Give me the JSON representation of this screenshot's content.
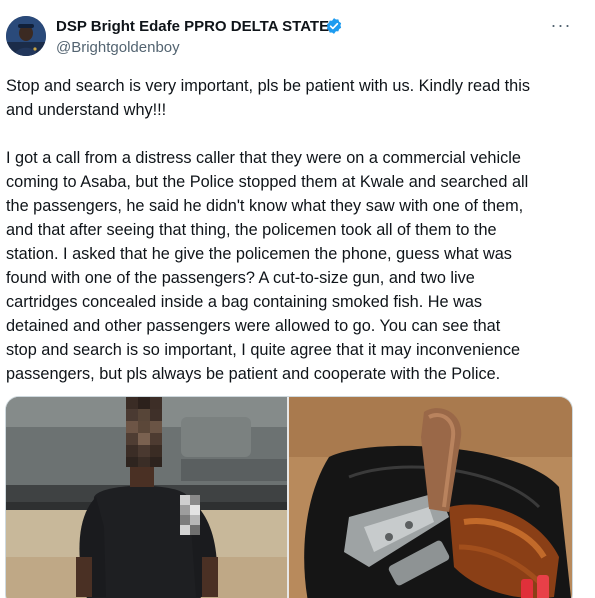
{
  "author": {
    "name": "DSP Bright Edafe PPRO DELTA STATE",
    "handle": "@Brightgoldenboy",
    "verified": true
  },
  "more_label": "···",
  "tweet": {
    "paragraph_1": "Stop and search is very important, pls be patient with us. Kindly read this\nand understand why!!!",
    "paragraph_2": "I got a call from a distress caller that they were on a commercial vehicle\ncoming to Asaba, but the Police stopped them at Kwale and searched all\nthe passengers, he said he didn't know what they saw with one of them,\nand that after seeing that thing, the policemen took all of them to the\nstation.  I asked that he give the policemen the phone, guess what was\nfound with one of the passengers? A cut-to-size gun, and two live\ncartridges concealed inside a bag containing smoked fish. He was\ndetained and other passengers were allowed to go. You can see that\nstop and search is so important, I quite agree that it may inconvenience\npassengers, but pls always be patient and cooperate with the Police."
  },
  "colors": {
    "text": "#0f1419",
    "secondary": "#536471",
    "verified_blue": "#1d9bf0",
    "border": "#cfd9de"
  },
  "icons": {
    "verified": "verified-badge-icon",
    "more": "more-horizontal-icon"
  }
}
